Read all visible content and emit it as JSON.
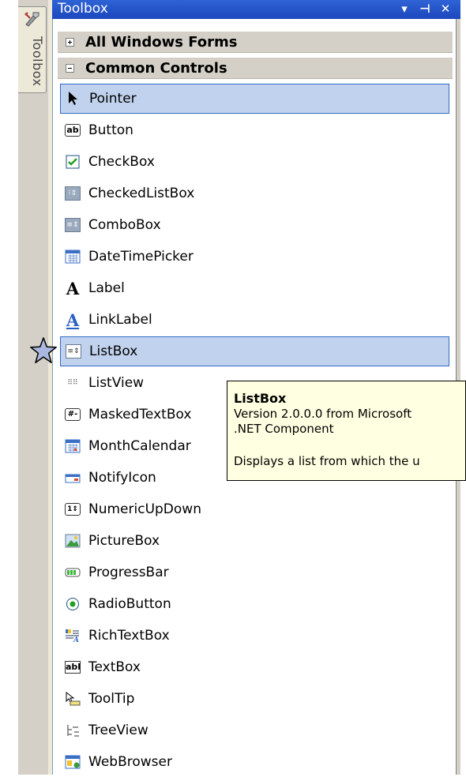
{
  "side_tab": {
    "label": "Toolbox",
    "icon": "toolbox-icon"
  },
  "titlebar": {
    "title": "Toolbox",
    "buttons": {
      "dropdown": "▾",
      "pin": "⊣",
      "close": "✕"
    }
  },
  "groups": [
    {
      "label": "All Windows Forms",
      "expanded": false
    },
    {
      "label": "Common Controls",
      "expanded": true
    }
  ],
  "items": [
    {
      "label": "Pointer",
      "icon": "pointer-icon",
      "selected": true
    },
    {
      "label": "Button",
      "icon": "button-icon"
    },
    {
      "label": "CheckBox",
      "icon": "checkbox-icon"
    },
    {
      "label": "CheckedListBox",
      "icon": "checkedlistbox-icon"
    },
    {
      "label": "ComboBox",
      "icon": "combobox-icon"
    },
    {
      "label": "DateTimePicker",
      "icon": "datetimepicker-icon"
    },
    {
      "label": "Label",
      "icon": "label-icon"
    },
    {
      "label": "LinkLabel",
      "icon": "linklabel-icon"
    },
    {
      "label": "ListBox",
      "icon": "listbox-icon",
      "selected": true
    },
    {
      "label": "ListView",
      "icon": "listview-icon"
    },
    {
      "label": "MaskedTextBox",
      "icon": "maskedtextbox-icon"
    },
    {
      "label": "MonthCalendar",
      "icon": "monthcalendar-icon"
    },
    {
      "label": "NotifyIcon",
      "icon": "notifyicon-icon"
    },
    {
      "label": "NumericUpDown",
      "icon": "numericupdown-icon"
    },
    {
      "label": "PictureBox",
      "icon": "picturebox-icon"
    },
    {
      "label": "ProgressBar",
      "icon": "progressbar-icon"
    },
    {
      "label": "RadioButton",
      "icon": "radiobutton-icon"
    },
    {
      "label": "RichTextBox",
      "icon": "richtextbox-icon"
    },
    {
      "label": "TextBox",
      "icon": "textbox-icon"
    },
    {
      "label": "ToolTip",
      "icon": "tooltip-icon"
    },
    {
      "label": "TreeView",
      "icon": "treeview-icon"
    },
    {
      "label": "WebBrowser",
      "icon": "webbrowser-icon"
    }
  ],
  "tooltip": {
    "title": "ListBox",
    "version": "Version 2.0.0.0 from Microsoft",
    "component": ".NET Component",
    "description": "Displays a list from which the u"
  },
  "marker": {
    "icon": "star-icon",
    "color": "#aab8e0"
  },
  "colors": {
    "titlebar": "#2f63d5",
    "selection": "#c1d2ee",
    "selection_border": "#316ac5",
    "tooltip_bg": "#ffffe1"
  }
}
